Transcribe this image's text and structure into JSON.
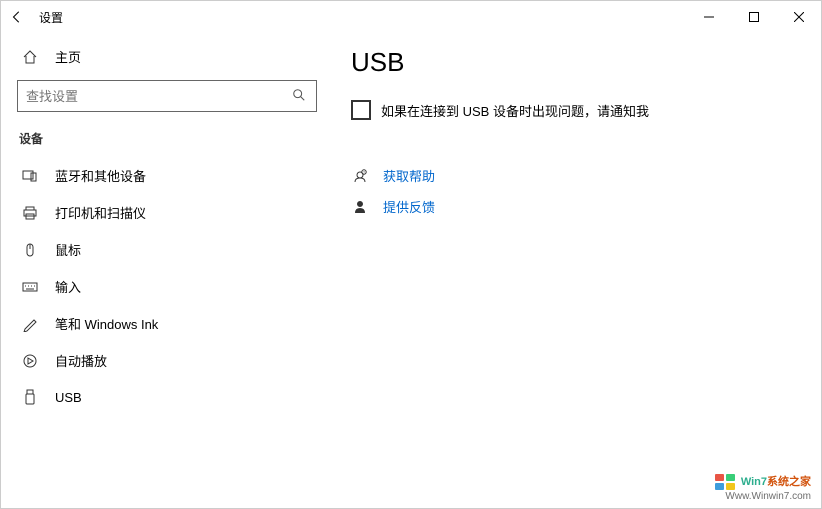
{
  "titlebar": {
    "title": "设置"
  },
  "sidebar": {
    "home_label": "主页",
    "search_placeholder": "查找设置",
    "section_label": "设备",
    "items": [
      {
        "label": "蓝牙和其他设备"
      },
      {
        "label": "打印机和扫描仪"
      },
      {
        "label": "鼠标"
      },
      {
        "label": "输入"
      },
      {
        "label": "笔和 Windows Ink"
      },
      {
        "label": "自动播放"
      },
      {
        "label": "USB"
      }
    ]
  },
  "main": {
    "title": "USB",
    "checkbox_label": "如果在连接到 USB 设备时出现问题，请通知我",
    "help_link": "获取帮助",
    "feedback_link": "提供反馈"
  },
  "watermark": {
    "line1_a": "Win7",
    "line1_b": "系统之家",
    "line2": "Www.Winwin7.com"
  }
}
